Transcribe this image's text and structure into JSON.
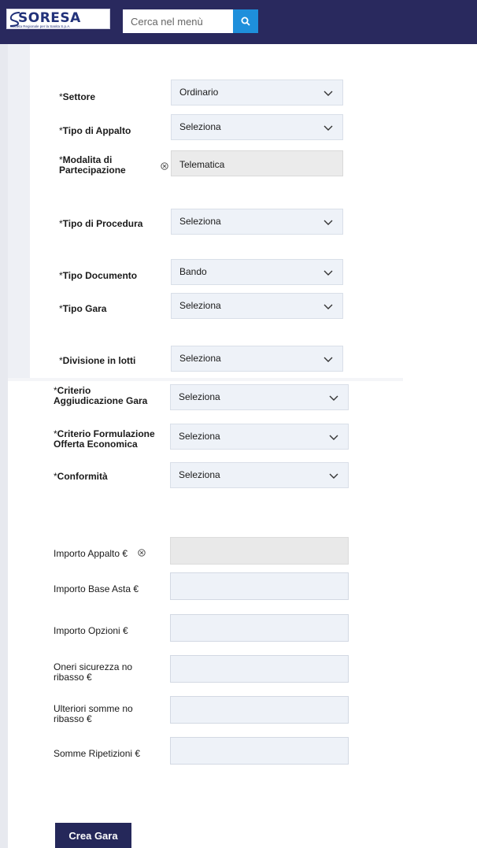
{
  "header": {
    "logo_text": "SORESA",
    "logo_subtitle": "Societa Regionale per la Sanita S.p.A.",
    "search_placeholder": "Cerca nel menù",
    "colors": {
      "header_bg": "#29295e",
      "search_button": "#1e8fdb"
    }
  },
  "required_mark": "*",
  "form": {
    "settore": {
      "label": "Settore",
      "value": "Ordinario"
    },
    "tipo_appalto": {
      "label": "Tipo di Appalto",
      "value": "Seleziona"
    },
    "modalita": {
      "label_line1": "Modalita di",
      "label_line2": "Partecipazione",
      "value": "Telematica"
    },
    "tipo_procedura": {
      "label": "Tipo di Procedura",
      "value": "Seleziona"
    },
    "tipo_documento": {
      "label": "Tipo Documento",
      "value": "Bando"
    },
    "tipo_gara": {
      "label": "Tipo Gara",
      "value": "Seleziona"
    },
    "divisione_lotti": {
      "label": "Divisione in lotti",
      "value": "Seleziona"
    },
    "criterio_aggiudicazione": {
      "label_line1": "Criterio",
      "label_line2": "Aggiudicazione Gara",
      "value": "Seleziona"
    },
    "criterio_formulazione": {
      "label_line1": "Criterio Formulazione",
      "label_line2": "Offerta Economica",
      "value": "Seleziona"
    },
    "conformita": {
      "label": "Conformità",
      "value": "Seleziona"
    }
  },
  "amounts": {
    "importo_appalto": {
      "label": "Importo Appalto €"
    },
    "importo_base_asta": {
      "label": "Importo Base Asta €"
    },
    "importo_opzioni": {
      "label": "Importo Opzioni €"
    },
    "oneri_sicurezza": {
      "label_line1": "Oneri sicurezza no",
      "label_line2": "ribasso €"
    },
    "ulteriori_somme": {
      "label_line1": "Ulteriori somme no",
      "label_line2": "ribasso €"
    },
    "somme_ripetizioni": {
      "label": "Somme Ripetizioni €"
    }
  },
  "actions": {
    "crea_gara": "Crea Gara",
    "button_color": "#25285a"
  }
}
